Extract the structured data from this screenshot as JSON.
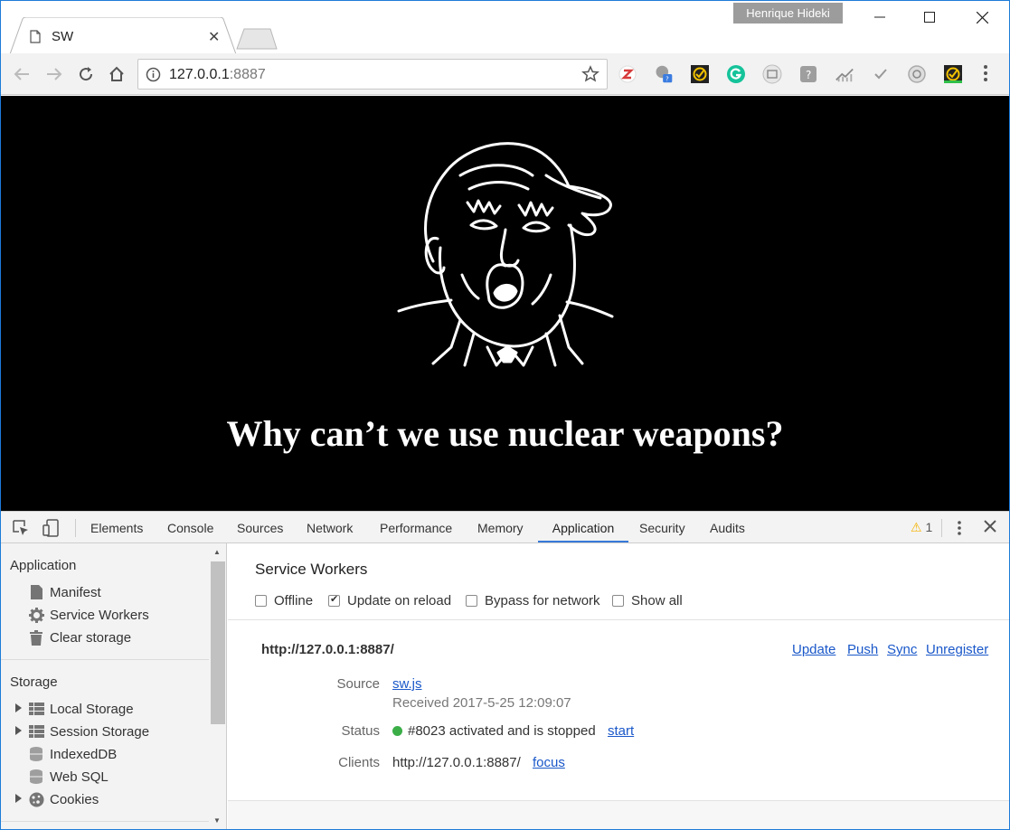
{
  "window": {
    "profile_name": "Henrique Hideki",
    "minimize": "—",
    "maximize": "☐",
    "close": "✕"
  },
  "tab": {
    "title": "SW",
    "close": "✕"
  },
  "toolbar": {
    "url_host": "127.0.0.1",
    "url_port": ":8887"
  },
  "page": {
    "headline": "Why can’t we use nuclear weapons?"
  },
  "devtools": {
    "tabs": [
      "Elements",
      "Console",
      "Sources",
      "Network",
      "Performance",
      "Memory",
      "Application",
      "Security",
      "Audits"
    ],
    "active_tab": "Application",
    "warning_count": "1",
    "sidebar": {
      "application_header": "Application",
      "application_items": [
        "Manifest",
        "Service Workers",
        "Clear storage"
      ],
      "storage_header": "Storage",
      "storage_items": [
        "Local Storage",
        "Session Storage",
        "IndexedDB",
        "Web SQL",
        "Cookies"
      ]
    },
    "service_workers": {
      "title": "Service Workers",
      "options": [
        {
          "label": "Offline",
          "checked": false
        },
        {
          "label": "Update on reload",
          "checked": true
        },
        {
          "label": "Bypass for network",
          "checked": false
        },
        {
          "label": "Show all",
          "checked": false
        }
      ],
      "origin": "http://127.0.0.1:8887/",
      "actions": [
        "Update",
        "Push",
        "Sync",
        "Unregister"
      ],
      "source_label": "Source",
      "source_file": "sw.js",
      "received": "Received 2017-5-25 12:09:07",
      "status_label": "Status",
      "status_text": "#8023 activated and is stopped",
      "status_action": "start",
      "status_color": "#3bae48",
      "clients_label": "Clients",
      "client_url": "http://127.0.0.1:8887/",
      "client_action": "focus"
    }
  }
}
